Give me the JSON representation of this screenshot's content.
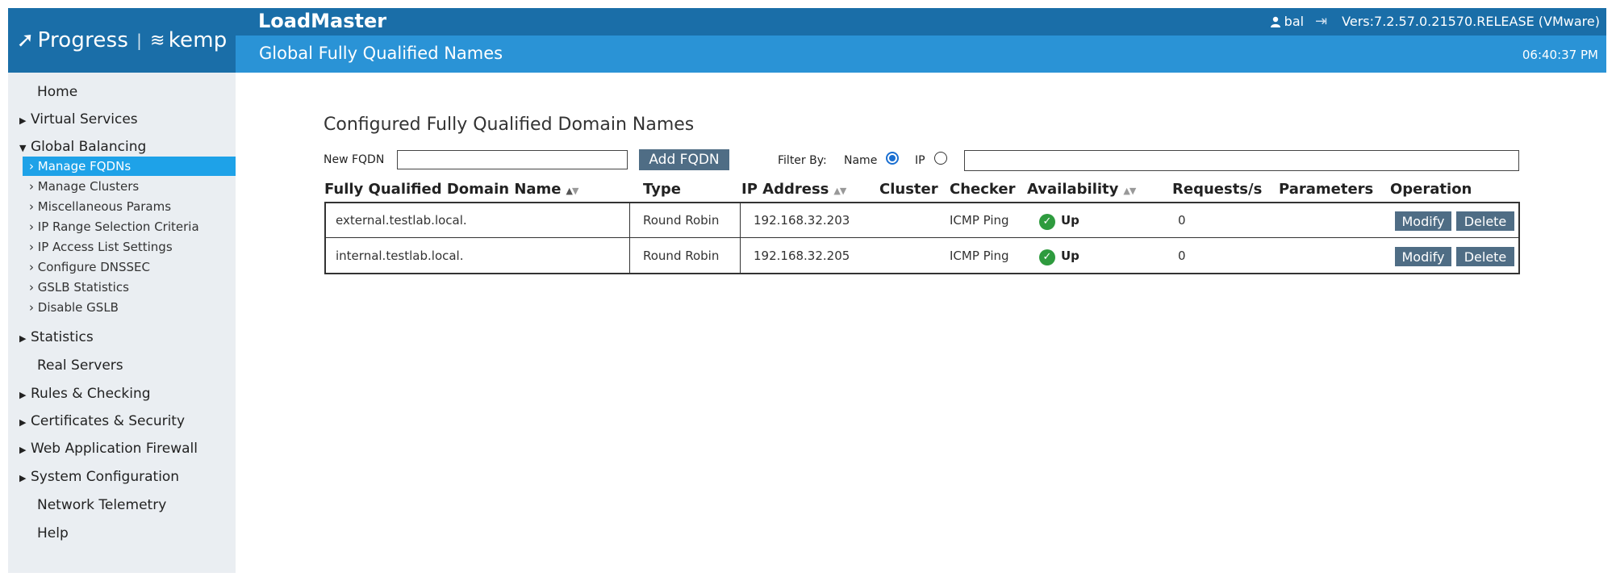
{
  "brand": {
    "progress": "Progress",
    "separator": "|",
    "kemp": "kemp"
  },
  "header": {
    "app_title": "LoadMaster",
    "user": "bal",
    "version": "Vers:7.2.57.0.21570.RELEASE (VMware)",
    "page_title": "Global Fully Qualified Names",
    "clock": "06:40:37 PM"
  },
  "sidebar": {
    "items": [
      {
        "label": "Home",
        "expandable": false
      },
      {
        "label": "Virtual Services",
        "expandable": true,
        "expanded": false
      },
      {
        "label": "Global Balancing",
        "expandable": true,
        "expanded": true
      },
      {
        "label": "Statistics",
        "expandable": true,
        "expanded": false
      },
      {
        "label": "Real Servers",
        "expandable": false
      },
      {
        "label": "Rules & Checking",
        "expandable": true,
        "expanded": false
      },
      {
        "label": "Certificates & Security",
        "expandable": true,
        "expanded": false
      },
      {
        "label": "Web Application Firewall",
        "expandable": true,
        "expanded": false
      },
      {
        "label": "System Configuration",
        "expandable": true,
        "expanded": false
      },
      {
        "label": "Network Telemetry",
        "expandable": false
      },
      {
        "label": "Help",
        "expandable": false
      }
    ],
    "sub_items": [
      {
        "label": "› Manage FQDNs",
        "active": true
      },
      {
        "label": "› Manage Clusters",
        "active": false
      },
      {
        "label": "› Miscellaneous Params",
        "active": false
      },
      {
        "label": "› IP Range Selection Criteria",
        "active": false
      },
      {
        "label": "› IP Access List Settings",
        "active": false
      },
      {
        "label": "› Configure DNSSEC",
        "active": false
      },
      {
        "label": "› GSLB Statistics",
        "active": false
      },
      {
        "label": "› Disable GSLB",
        "active": false
      }
    ]
  },
  "content": {
    "section_title": "Configured Fully Qualified Domain Names",
    "new_fqdn_label": "New FQDN",
    "new_fqdn_value": "",
    "add_button": "Add FQDN",
    "filter_label": "Filter By:",
    "filter_name": "Name",
    "filter_ip": "IP",
    "filter_selected": "Name",
    "filter_value": ""
  },
  "table": {
    "columns": [
      "Fully Qualified Domain Name",
      "Type",
      "IP Address",
      "Cluster",
      "Checker",
      "Availability",
      "Requests/s",
      "Parameters",
      "Operation"
    ],
    "rows": [
      {
        "fqdn": "external.testlab.local.",
        "type": "Round Robin",
        "ip": "192.168.32.203",
        "cluster": "",
        "checker": "ICMP Ping",
        "availability": "Up",
        "requests": "0",
        "parameters": "",
        "modify": "Modify",
        "delete": "Delete"
      },
      {
        "fqdn": "internal.testlab.local.",
        "type": "Round Robin",
        "ip": "192.168.32.205",
        "cluster": "",
        "checker": "ICMP Ping",
        "availability": "Up",
        "requests": "0",
        "parameters": "",
        "modify": "Modify",
        "delete": "Delete"
      }
    ]
  },
  "colors": {
    "header_dark": "#1a6ea8",
    "header_light": "#2a93d6",
    "active_nav": "#1ea2e8",
    "button": "#4f6d85",
    "status_ok": "#2e9b3e"
  }
}
